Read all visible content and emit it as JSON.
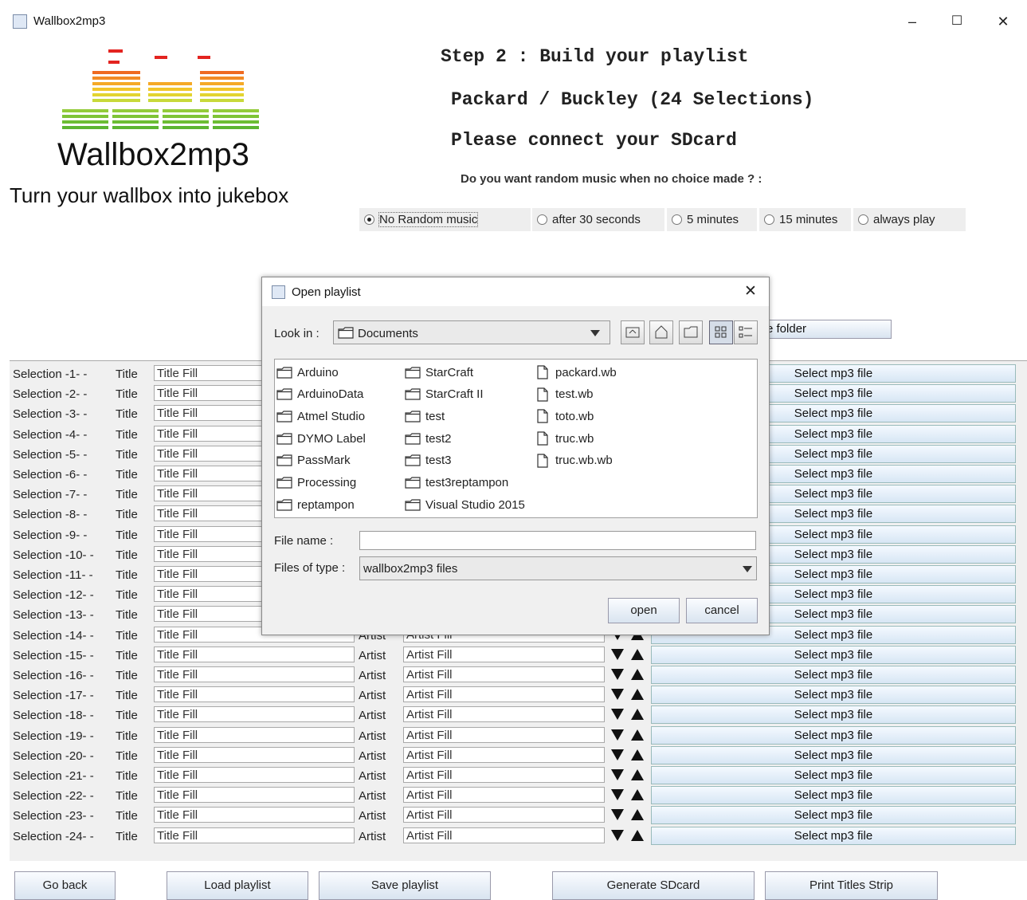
{
  "window": {
    "title": "Wallbox2mp3",
    "minimize": "–",
    "maximize": "☐",
    "close": "✕"
  },
  "logo": {
    "name": "Wallbox2mp3",
    "tagline": "Turn your wallbox into jukebox"
  },
  "header": {
    "step": "Step 2 : Build your playlist",
    "model": "Packard / Buckley (24 Selections)",
    "connect": "Please connect your SDcard",
    "random_question": "Do you want random music when no choice made ? :"
  },
  "random_options": [
    {
      "label": "No Random music",
      "selected": true
    },
    {
      "label": "after 30 seconds",
      "selected": false
    },
    {
      "label": "5 minutes",
      "selected": false
    },
    {
      "label": "15 minutes",
      "selected": false
    },
    {
      "label": "always play",
      "selected": false
    }
  ],
  "folder_button_partial": "e folder",
  "table": {
    "title_label": "Title",
    "artist_label": "Artist",
    "title_placeholder": "Title Fill",
    "artist_placeholder": "Artist Fill",
    "select_label": "Select mp3 file",
    "rows": [
      "Selection -1- -",
      "Selection -2- -",
      "Selection -3- -",
      "Selection -4- -",
      "Selection -5- -",
      "Selection -6- -",
      "Selection -7- -",
      "Selection -8- -",
      "Selection -9- -",
      "Selection -10- -",
      "Selection -11- -",
      "Selection -12- -",
      "Selection -13- -",
      "Selection -14- -",
      "Selection -15- -",
      "Selection -16- -",
      "Selection -17- -",
      "Selection -18- -",
      "Selection -19- -",
      "Selection -20- -",
      "Selection -21- -",
      "Selection -22- -",
      "Selection -23- -",
      "Selection -24- -"
    ]
  },
  "bottom_buttons": {
    "go_back": "Go back",
    "load": "Load playlist",
    "save": "Save playlist",
    "generate": "Generate SDcard",
    "print": "Print Titles Strip"
  },
  "dialog": {
    "title": "Open playlist",
    "look_in_label": "Look in :",
    "look_in_value": "Documents",
    "folders_col1": [
      "Arduino",
      "ArduinoData",
      "Atmel Studio",
      "DYMO Label",
      "PassMark",
      "Processing",
      "reptampon"
    ],
    "folders_col2": [
      "StarCraft",
      "StarCraft II",
      "test",
      "test2",
      "test3",
      "test3reptampon",
      "Visual Studio 2015"
    ],
    "files_col3": [
      "packard.wb",
      "test.wb",
      "toto.wb",
      "truc.wb",
      "truc.wb.wb"
    ],
    "file_name_label": "File name :",
    "file_name_value": "",
    "files_of_type_label": "Files of type :",
    "files_of_type_value": "wallbox2mp3 files",
    "open": "open",
    "cancel": "cancel"
  }
}
